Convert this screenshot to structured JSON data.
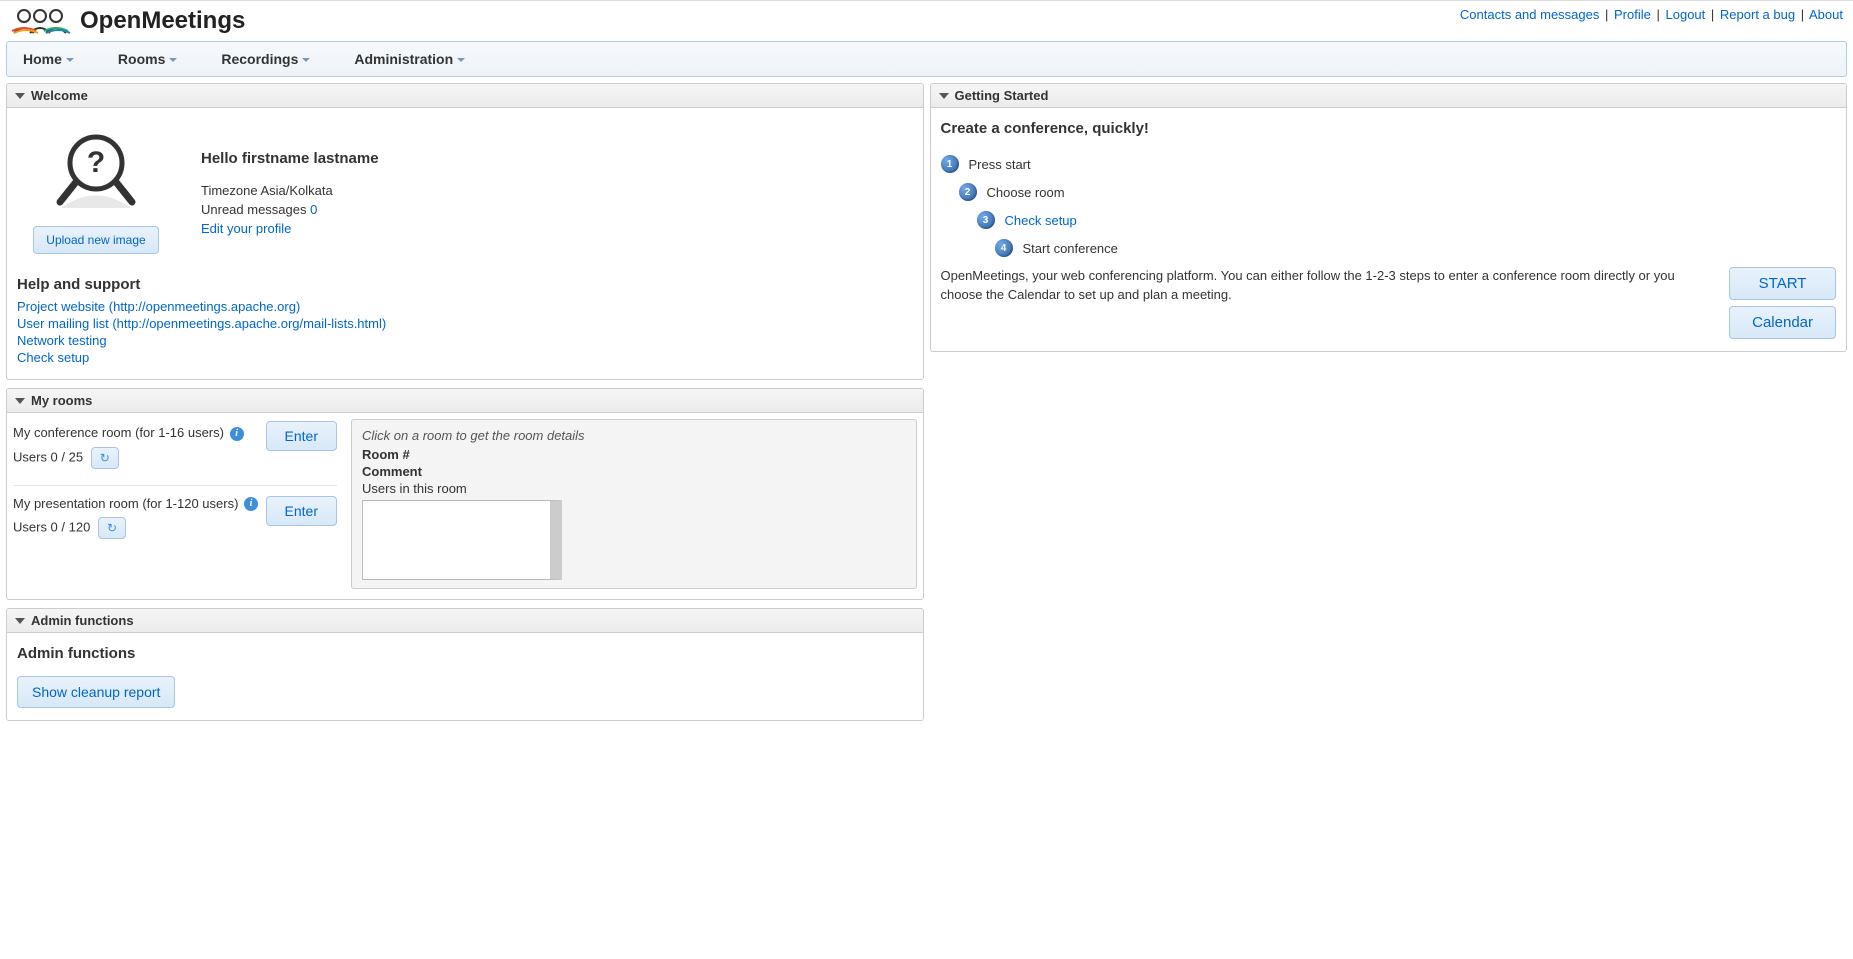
{
  "brand": {
    "title": "OpenMeetings"
  },
  "topnav": {
    "contacts": "Contacts and messages",
    "profile": "Profile",
    "logout": "Logout",
    "report": "Report a bug",
    "about": "About"
  },
  "menu": {
    "home": "Home",
    "rooms": "Rooms",
    "recordings": "Recordings",
    "administration": "Administration"
  },
  "welcome": {
    "title": "Welcome",
    "upload_btn": "Upload new image",
    "greeting": "Hello firstname lastname",
    "timezone": "Timezone Asia/Kolkata",
    "unread_label": "Unread messages ",
    "unread_count": "0",
    "edit_profile": "Edit your profile",
    "help_heading": "Help and support",
    "links": {
      "project": "Project website (http://openmeetings.apache.org)",
      "mailing": "User mailing list (http://openmeetings.apache.org/mail-lists.html)",
      "network": "Network testing",
      "check": "Check setup"
    }
  },
  "myrooms": {
    "title": "My rooms",
    "rooms": [
      {
        "name": "My conference room (for 1-16 users)",
        "users": "Users 0 / 25",
        "enter": "Enter"
      },
      {
        "name": "My presentation room (for 1-120 users)",
        "users": "Users 0 / 120",
        "enter": "Enter"
      }
    ],
    "details": {
      "hint": "Click on a room to get the room details",
      "room_label": "Room #",
      "comment_label": "Comment",
      "users_label": "Users in this room"
    }
  },
  "admin": {
    "title": "Admin functions",
    "heading": "Admin functions",
    "cleanup": "Show cleanup report"
  },
  "getting_started": {
    "title": "Getting Started",
    "heading": "Create a conference, quickly!",
    "steps": {
      "s1": "Press start",
      "s2": "Choose room",
      "s3": "Check setup",
      "s4": "Start conference"
    },
    "desc": "OpenMeetings, your web conferencing platform. You can either follow the 1-2-3 steps to enter a conference room directly or you choose the Calendar to set up and plan a meeting.",
    "start_btn": "START",
    "calendar_btn": "Calendar"
  }
}
